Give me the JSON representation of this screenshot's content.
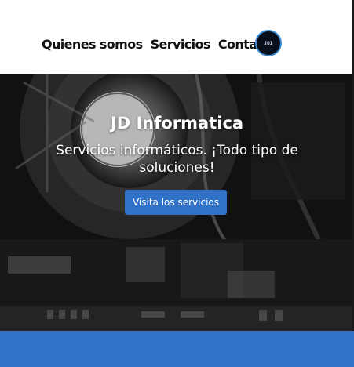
{
  "nav": {
    "items": [
      {
        "label": "Quienes somos"
      },
      {
        "label": "Servicios"
      },
      {
        "label": "Contacto"
      }
    ]
  },
  "logo": {
    "mark": "JDI"
  },
  "hero": {
    "title": "JD Informatica",
    "subtitle": "Servicios informáticos. ¡Todo tipo de soluciones!",
    "button_label": "Visita los servicios"
  },
  "colors": {
    "accent": "#2f72c8",
    "hero_dark": "#111111"
  }
}
